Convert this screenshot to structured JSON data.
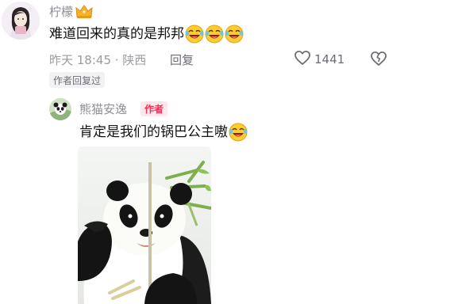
{
  "top_comment": {
    "username": "柠檬",
    "text": "难道回来的真的是邦邦",
    "emojis": [
      "laughing-tears-emoji",
      "laughing-tears-emoji",
      "laughing-tears-emoji"
    ],
    "timestamp": "昨天 18:45 · 陕西",
    "reply_label": "回复",
    "like_count": "1441",
    "badge": "作者回复过"
  },
  "reply": {
    "username": "熊猫安逸",
    "author_tag": "作者",
    "text": "肯定是我们的锅巴公主嗷",
    "emoji": "laughing-tears-emoji",
    "image_subject": "panda"
  },
  "colors": {
    "accent": "#fe2c55",
    "author_tag_bg": "#fde6ec",
    "meta_text": "#9b9ba1",
    "badge_bg": "#f2f2f4"
  }
}
